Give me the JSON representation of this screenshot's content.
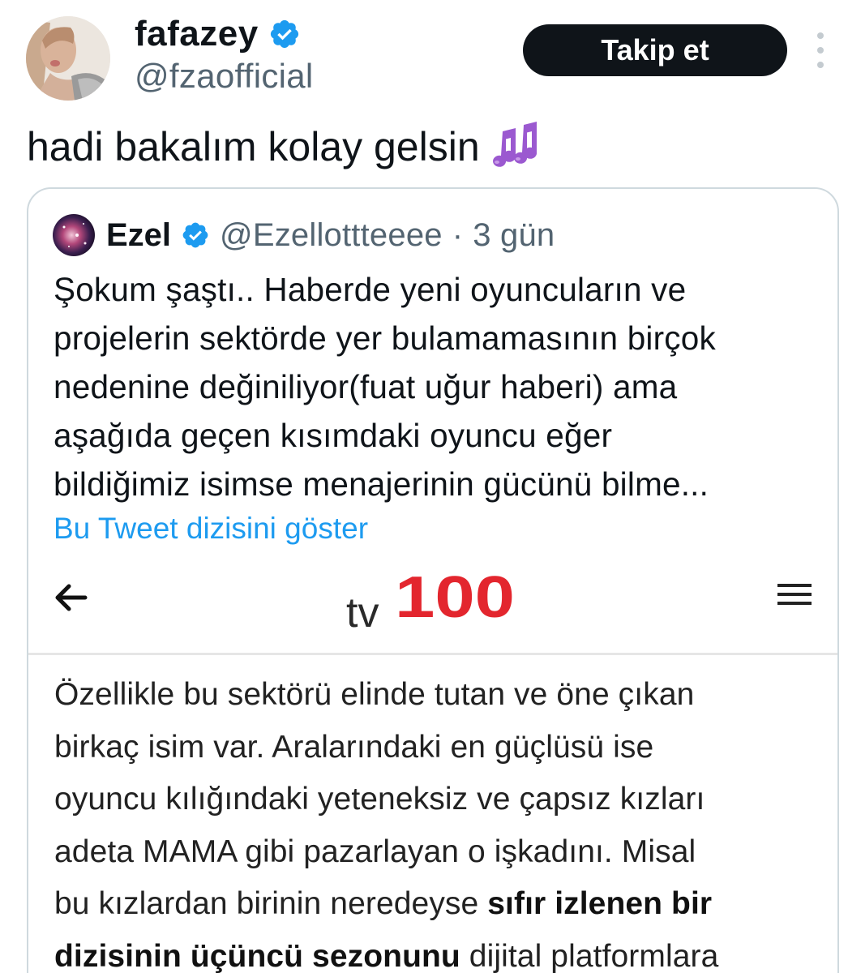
{
  "tweet": {
    "author": {
      "display_name": "fafazey",
      "handle": "@fzaofficial",
      "verified_icon": "verified-badge-icon"
    },
    "follow_label": "Takip et",
    "more_icon": "more-vertical-icon",
    "text": "hadi bakalım kolay gelsin",
    "emoji_icon": "musical-notes-icon",
    "colors": {
      "verified": "#1d9bf0",
      "link": "#1d9bf0",
      "button_bg": "#0f1419",
      "secondary_text": "#536471"
    }
  },
  "quote": {
    "author": {
      "display_name": "Ezel",
      "handle": "@Ezellottteeee",
      "separator": "·",
      "time": "3 gün"
    },
    "body_lines": [
      "Şokum şaştı.. Haberde yeni oyuncuların ve",
      "projelerin sektörde yer bulamamasının birçok",
      "nedenine değiniliyor(fuat uğur haberi) ama",
      "aşağıda geçen kısımdaki oyuncu eğer",
      "bildiğimiz isimse menajerinin gücünü bilme..."
    ],
    "show_thread_label": "Bu Tweet dizisini göster"
  },
  "embed": {
    "logo_text": "tv100",
    "logo_prefix": "tv",
    "logo_number": "100",
    "back_icon": "arrow-left-icon",
    "menu_icon": "hamburger-menu-icon",
    "logo_color": "#e3262e",
    "lines": [
      {
        "pre": "Özellikle bu sektörü elinde tutan ve öne çıkan",
        "bold": "",
        "post": ""
      },
      {
        "pre": "birkaç isim var. Aralarındaki en güçlüsü ise",
        "bold": "",
        "post": ""
      },
      {
        "pre": "oyuncu kılığındaki yeteneksiz ve çapsız kızları",
        "bold": "",
        "post": ""
      },
      {
        "pre": "adeta MAMA gibi pazarlayan o işkadını. Misal",
        "bold": "",
        "post": ""
      },
      {
        "pre": "bu kızlardan birinin neredeyse ",
        "bold": "sıfır izlenen bir",
        "post": ""
      },
      {
        "pre": "",
        "bold": "dizisinin üçüncü sezonunu",
        "post": " dijital platformlara"
      }
    ]
  }
}
